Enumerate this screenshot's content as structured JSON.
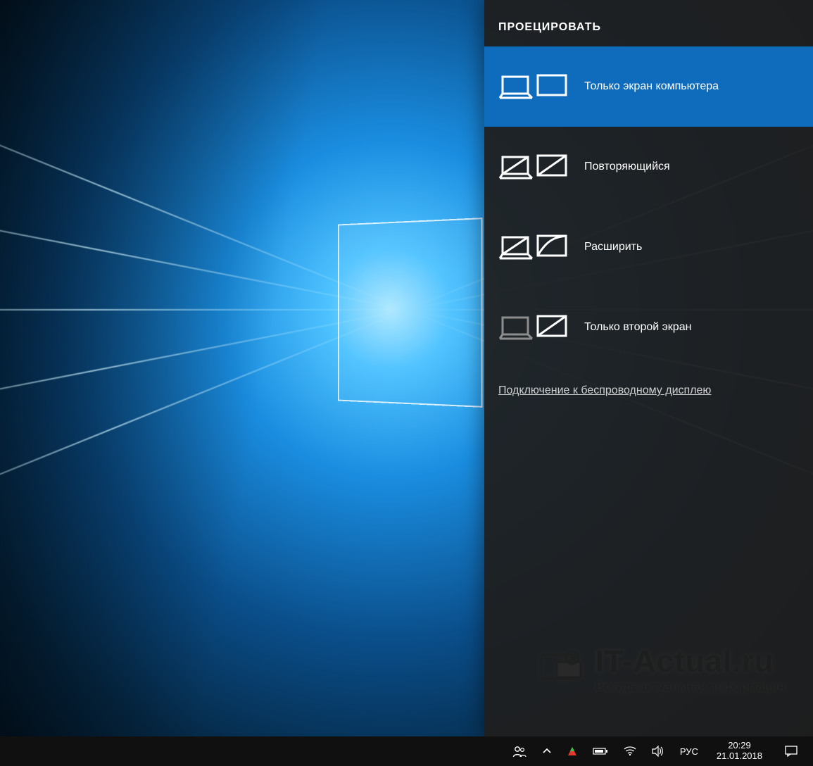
{
  "panel": {
    "title": "ПРОЕЦИРОВАТЬ",
    "options": {
      "pc_only": "Только экран компьютера",
      "duplicate": "Повторяющийся",
      "extend": "Расширить",
      "second_only": "Только второй экран"
    },
    "wireless_link": "Подключение к беспроводному дисплею"
  },
  "taskbar": {
    "language": "РУС",
    "time": "20:29",
    "date": "21.01.2018"
  },
  "watermark": {
    "title": "IT-Actual.ru",
    "subtitle": "Всегда актуальная информация"
  }
}
